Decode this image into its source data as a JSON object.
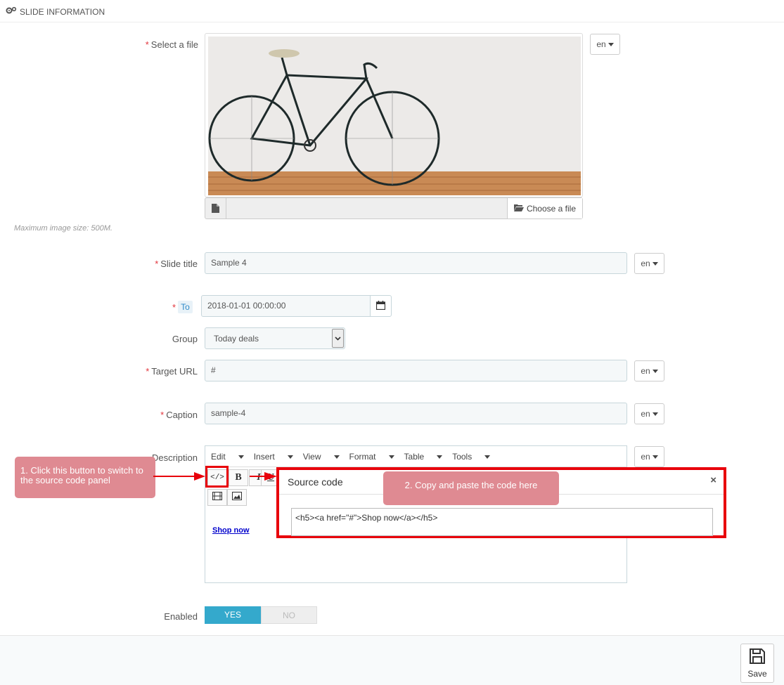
{
  "panel": {
    "title": "SLIDE INFORMATION",
    "icon": "gears-icon"
  },
  "fields": {
    "file": {
      "label": "Select a file",
      "lang": "en",
      "choose_label": "Choose a file",
      "max_size_hint": "Maximum image size: 500M."
    },
    "slide_title": {
      "label": "Slide title",
      "value": "Sample 4",
      "lang": "en"
    },
    "date_to": {
      "tag": "To",
      "value": "2018-01-01 00:00:00"
    },
    "group": {
      "label": "Group",
      "value": "Today deals"
    },
    "target_url": {
      "label": "Target URL",
      "value": "#",
      "lang": "en"
    },
    "caption": {
      "label": "Caption",
      "value": "sample-4",
      "lang": "en"
    },
    "description": {
      "label": "Description",
      "lang": "en",
      "menu": [
        "Edit",
        "Insert",
        "View",
        "Format",
        "Table",
        "Tools"
      ],
      "toolbar": {
        "code_label": "</>",
        "bold_label": "B",
        "italic_label": "I",
        "underline_label": "U"
      },
      "content_link": "Shop now"
    },
    "enabled": {
      "label": "Enabled",
      "yes": "YES",
      "no": "NO"
    }
  },
  "source_dialog": {
    "title": "Source code",
    "close": "×",
    "code": "<h5><a href=\"#\">Shop now</a></h5>"
  },
  "callouts": {
    "step1": "1. Click this button to switch to the source code panel",
    "step2": "2. Copy and paste the code here"
  },
  "footer": {
    "save_label": "Save"
  },
  "colors": {
    "accent": "#34a9cc",
    "required": "#e2343c",
    "annotation_red": "#e8000b",
    "callout_bg": "#df8a92"
  }
}
